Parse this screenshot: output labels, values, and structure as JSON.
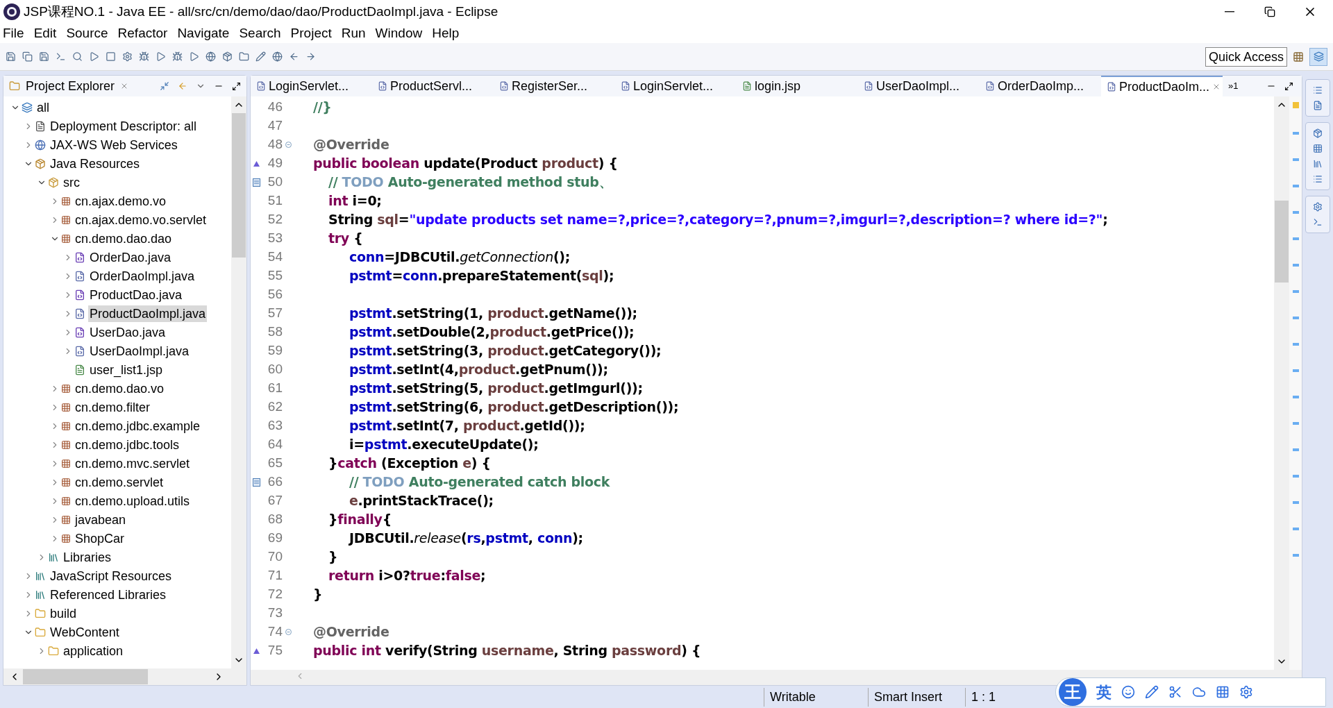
{
  "window": {
    "title": "JSP课程NO.1 - Java EE - all/src/cn/demo/dao/dao/ProductDaoImpl.java - Eclipse"
  },
  "menu": [
    "File",
    "Edit",
    "Source",
    "Refactor",
    "Navigate",
    "Search",
    "Project",
    "Run",
    "Window",
    "Help"
  ],
  "quick_access": "Quick Access",
  "explorer": {
    "title": "Project Explorer",
    "tree": [
      {
        "label": "all",
        "kind": "project",
        "expanded": true,
        "selected": false,
        "children": [
          {
            "label": "Deployment Descriptor: all",
            "kind": "descriptor",
            "expanded": false,
            "selected": false
          },
          {
            "label": "JAX-WS Web Services",
            "kind": "webservice",
            "expanded": false,
            "selected": false
          },
          {
            "label": "Java Resources",
            "kind": "resources",
            "expanded": true,
            "selected": false,
            "children": [
              {
                "label": "src",
                "kind": "srcfolder",
                "expanded": true,
                "selected": false,
                "children": [
                  {
                    "label": "cn.ajax.demo.vo",
                    "kind": "package",
                    "expanded": false,
                    "selected": false
                  },
                  {
                    "label": "cn.ajax.demo.vo.servlet",
                    "kind": "package",
                    "expanded": false,
                    "selected": false
                  },
                  {
                    "label": "cn.demo.dao.dao",
                    "kind": "package",
                    "expanded": true,
                    "selected": false,
                    "children": [
                      {
                        "label": "OrderDao.java",
                        "kind": "interface",
                        "expanded": false,
                        "selected": false
                      },
                      {
                        "label": "OrderDaoImpl.java",
                        "kind": "class",
                        "expanded": false,
                        "selected": false
                      },
                      {
                        "label": "ProductDao.java",
                        "kind": "interface",
                        "expanded": false,
                        "selected": false
                      },
                      {
                        "label": "ProductDaoImpl.java",
                        "kind": "class",
                        "expanded": false,
                        "selected": true
                      },
                      {
                        "label": "UserDao.java",
                        "kind": "interface",
                        "expanded": false,
                        "selected": false
                      },
                      {
                        "label": "UserDaoImpl.java",
                        "kind": "class",
                        "expanded": false,
                        "selected": false
                      },
                      {
                        "label": "user_list1.jsp",
                        "kind": "jsp",
                        "selected": false
                      }
                    ]
                  },
                  {
                    "label": "cn.demo.dao.vo",
                    "kind": "package",
                    "expanded": false,
                    "selected": false
                  },
                  {
                    "label": "cn.demo.filter",
                    "kind": "package",
                    "expanded": false,
                    "selected": false
                  },
                  {
                    "label": "cn.demo.jdbc.example",
                    "kind": "package",
                    "expanded": false,
                    "selected": false
                  },
                  {
                    "label": "cn.demo.jdbc.tools",
                    "kind": "package",
                    "expanded": false,
                    "selected": false
                  },
                  {
                    "label": "cn.demo.mvc.servlet",
                    "kind": "package",
                    "expanded": false,
                    "selected": false
                  },
                  {
                    "label": "cn.demo.servlet",
                    "kind": "package",
                    "expanded": false,
                    "selected": false
                  },
                  {
                    "label": "cn.demo.upload.utils",
                    "kind": "package",
                    "expanded": false,
                    "selected": false
                  },
                  {
                    "label": "javabean",
                    "kind": "package",
                    "expanded": false,
                    "selected": false
                  },
                  {
                    "label": "ShopCar",
                    "kind": "package",
                    "expanded": false,
                    "selected": false
                  }
                ]
              },
              {
                "label": "Libraries",
                "kind": "library",
                "expanded": false,
                "selected": false
              }
            ]
          },
          {
            "label": "JavaScript Resources",
            "kind": "library",
            "expanded": false,
            "selected": false
          },
          {
            "label": "Referenced Libraries",
            "kind": "library",
            "expanded": false,
            "selected": false
          },
          {
            "label": "build",
            "kind": "folder",
            "expanded": false,
            "selected": false
          },
          {
            "label": "WebContent",
            "kind": "folder",
            "expanded": true,
            "selected": false,
            "children": [
              {
                "label": "application",
                "kind": "folder",
                "expanded": false,
                "selected": false
              }
            ]
          }
        ]
      }
    ]
  },
  "tabs": [
    {
      "label": "LoginServlet...",
      "kind": "class",
      "selected": false
    },
    {
      "label": "ProductServl...",
      "kind": "class",
      "selected": false
    },
    {
      "label": "RegisterSer...",
      "kind": "class",
      "selected": false
    },
    {
      "label": "LoginServlet...",
      "kind": "class",
      "selected": false
    },
    {
      "label": "login.jsp",
      "kind": "jsp",
      "selected": false
    },
    {
      "label": "UserDaoImpl...",
      "kind": "class",
      "selected": false
    },
    {
      "label": "OrderDaoImp...",
      "kind": "class",
      "selected": false
    },
    {
      "label": "ProductDaoIm...",
      "kind": "class",
      "selected": true
    }
  ],
  "tabs_overflow": "»1",
  "code": [
    {
      "num": "46",
      "kind": "line",
      "tokens": [
        {
          "kind": "comment",
          "text": "//}"
        }
      ]
    },
    {
      "num": "47",
      "kind": "line"
    },
    {
      "num": "48",
      "kind": "fold",
      "tokens": [
        {
          "kind": "ann",
          "text": "@Override"
        }
      ]
    },
    {
      "num": "49",
      "kind": "override",
      "tokens": [
        {
          "kind": "kw",
          "text": "public boolean "
        },
        {
          "kind": "plain",
          "text": "update(Product "
        },
        {
          "kind": "local",
          "text": "product"
        },
        {
          "kind": "plain",
          "text": ") {"
        }
      ]
    },
    {
      "num": "50",
      "kind": "task",
      "tokens": [
        {
          "kind": "comment",
          "text": "// "
        },
        {
          "kind": "todo",
          "text": "TODO"
        },
        {
          "kind": "comment",
          "text": " Auto-generated method stub、"
        }
      ]
    },
    {
      "num": "51",
      "kind": "line",
      "tokens": [
        {
          "kind": "kw",
          "text": "int "
        },
        {
          "kind": "plain",
          "text": "i=0;"
        }
      ]
    },
    {
      "num": "52",
      "kind": "line",
      "tokens": [
        {
          "kind": "plain",
          "text": "String "
        },
        {
          "kind": "local",
          "text": "sql"
        },
        {
          "kind": "plain",
          "text": "="
        },
        {
          "kind": "str",
          "text": "\"update products set name=?,price=?,category=?,pnum=?,imgurl=?,description=? where id=?\""
        },
        {
          "kind": "plain",
          "text": ";"
        }
      ]
    },
    {
      "num": "53",
      "kind": "line",
      "tokens": [
        {
          "kind": "kw",
          "text": "try"
        },
        {
          "kind": "plain",
          "text": " {"
        }
      ]
    },
    {
      "num": "54",
      "kind": "line",
      "tokens": [
        {
          "kind": "field",
          "text": "conn"
        },
        {
          "kind": "plain",
          "text": "=JDBCUtil."
        },
        {
          "kind": "static",
          "text": "getConnection"
        },
        {
          "kind": "plain",
          "text": "();"
        }
      ]
    },
    {
      "num": "55",
      "kind": "line",
      "tokens": [
        {
          "kind": "field",
          "text": "pstmt"
        },
        {
          "kind": "plain",
          "text": "="
        },
        {
          "kind": "field",
          "text": "conn"
        },
        {
          "kind": "plain",
          "text": ".prepareStatement("
        },
        {
          "kind": "local",
          "text": "sql"
        },
        {
          "kind": "plain",
          "text": ");"
        }
      ]
    },
    {
      "num": "56",
      "kind": "line"
    },
    {
      "num": "57",
      "kind": "line",
      "tokens": [
        {
          "kind": "field",
          "text": "pstmt"
        },
        {
          "kind": "plain",
          "text": ".setString(1, "
        },
        {
          "kind": "local",
          "text": "product"
        },
        {
          "kind": "plain",
          "text": ".getName());"
        }
      ]
    },
    {
      "num": "58",
      "kind": "line",
      "tokens": [
        {
          "kind": "field",
          "text": "pstmt"
        },
        {
          "kind": "plain",
          "text": ".setDouble(2,"
        },
        {
          "kind": "local",
          "text": "product"
        },
        {
          "kind": "plain",
          "text": ".getPrice());"
        }
      ]
    },
    {
      "num": "59",
      "kind": "line",
      "tokens": [
        {
          "kind": "field",
          "text": "pstmt"
        },
        {
          "kind": "plain",
          "text": ".setString(3, "
        },
        {
          "kind": "local",
          "text": "product"
        },
        {
          "kind": "plain",
          "text": ".getCategory());"
        }
      ]
    },
    {
      "num": "60",
      "kind": "line",
      "tokens": [
        {
          "kind": "field",
          "text": "pstmt"
        },
        {
          "kind": "plain",
          "text": ".setInt(4,"
        },
        {
          "kind": "local",
          "text": "product"
        },
        {
          "kind": "plain",
          "text": ".getPnum());"
        }
      ]
    },
    {
      "num": "61",
      "kind": "line",
      "tokens": [
        {
          "kind": "field",
          "text": "pstmt"
        },
        {
          "kind": "plain",
          "text": ".setString(5, "
        },
        {
          "kind": "local",
          "text": "product"
        },
        {
          "kind": "plain",
          "text": ".getImgurl());"
        }
      ]
    },
    {
      "num": "62",
      "kind": "line",
      "tokens": [
        {
          "kind": "field",
          "text": "pstmt"
        },
        {
          "kind": "plain",
          "text": ".setString(6, "
        },
        {
          "kind": "local",
          "text": "product"
        },
        {
          "kind": "plain",
          "text": ".getDescription());"
        }
      ]
    },
    {
      "num": "63",
      "kind": "line",
      "tokens": [
        {
          "kind": "field",
          "text": "pstmt"
        },
        {
          "kind": "plain",
          "text": ".setInt(7, "
        },
        {
          "kind": "local",
          "text": "product"
        },
        {
          "kind": "plain",
          "text": ".getId());"
        }
      ]
    },
    {
      "num": "64",
      "kind": "line",
      "tokens": [
        {
          "kind": "plain",
          "text": "i="
        },
        {
          "kind": "field",
          "text": "pstmt"
        },
        {
          "kind": "plain",
          "text": ".executeUpdate();"
        }
      ]
    },
    {
      "num": "65",
      "kind": "line",
      "tokens": [
        {
          "kind": "plain",
          "text": "}"
        },
        {
          "kind": "kw",
          "text": "catch"
        },
        {
          "kind": "plain",
          "text": " (Exception "
        },
        {
          "kind": "local",
          "text": "e"
        },
        {
          "kind": "plain",
          "text": ") {"
        }
      ]
    },
    {
      "num": "66",
      "kind": "task",
      "tokens": [
        {
          "kind": "comment",
          "text": "// "
        },
        {
          "kind": "todo",
          "text": "TODO"
        },
        {
          "kind": "comment",
          "text": " Auto-generated catch block"
        }
      ]
    },
    {
      "num": "67",
      "kind": "line",
      "tokens": [
        {
          "kind": "local",
          "text": "e"
        },
        {
          "kind": "plain",
          "text": ".printStackTrace();"
        }
      ]
    },
    {
      "num": "68",
      "kind": "line",
      "tokens": [
        {
          "kind": "plain",
          "text": "}"
        },
        {
          "kind": "kw",
          "text": "finally"
        },
        {
          "kind": "plain",
          "text": "{"
        }
      ]
    },
    {
      "num": "69",
      "kind": "line",
      "tokens": [
        {
          "kind": "plain",
          "text": "JDBCUtil."
        },
        {
          "kind": "static",
          "text": "release"
        },
        {
          "kind": "plain",
          "text": "("
        },
        {
          "kind": "field",
          "text": "rs"
        },
        {
          "kind": "plain",
          "text": ","
        },
        {
          "kind": "field",
          "text": "pstmt"
        },
        {
          "kind": "plain",
          "text": ", "
        },
        {
          "kind": "field",
          "text": "conn"
        },
        {
          "kind": "plain",
          "text": ");"
        }
      ]
    },
    {
      "num": "70",
      "kind": "line",
      "tokens": [
        {
          "kind": "plain",
          "text": "}"
        }
      ]
    },
    {
      "num": "71",
      "kind": "line",
      "tokens": [
        {
          "kind": "kw",
          "text": "return "
        },
        {
          "kind": "plain",
          "text": "i>0?"
        },
        {
          "kind": "kw",
          "text": "true"
        },
        {
          "kind": "plain",
          "text": ":"
        },
        {
          "kind": "kw",
          "text": "false"
        },
        {
          "kind": "plain",
          "text": ";"
        }
      ]
    },
    {
      "num": "72",
      "kind": "line",
      "tokens": [
        {
          "kind": "plain",
          "text": "}"
        }
      ]
    },
    {
      "num": "73",
      "kind": "line"
    },
    {
      "num": "74",
      "kind": "fold",
      "tokens": [
        {
          "kind": "ann",
          "text": "@Override"
        }
      ]
    },
    {
      "num": "75",
      "kind": "override",
      "tokens": [
        {
          "kind": "kw",
          "text": "public int "
        },
        {
          "kind": "plain",
          "text": "verify(String "
        },
        {
          "kind": "local",
          "text": "username"
        },
        {
          "kind": "plain",
          "text": ", String "
        },
        {
          "kind": "local",
          "text": "password"
        },
        {
          "kind": "plain",
          "text": ") {"
        }
      ]
    }
  ],
  "status_bar": [
    "Writable",
    "Smart Insert",
    "1 : 1"
  ],
  "ime_toolbar": {
    "logo": "王",
    "mode": "英"
  }
}
